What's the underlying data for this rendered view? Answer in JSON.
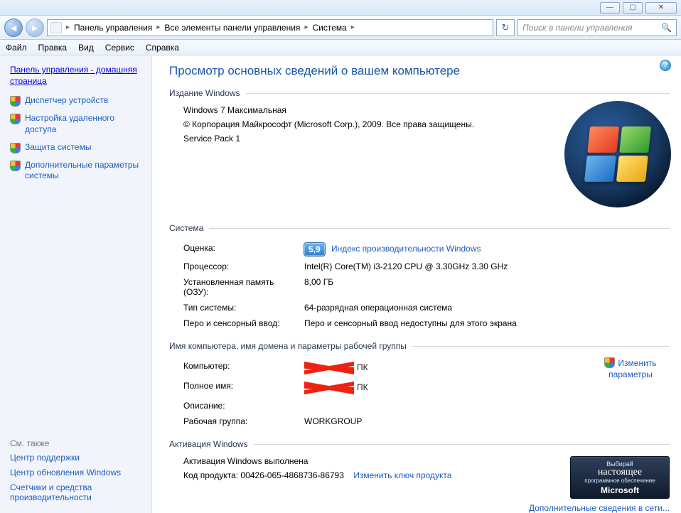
{
  "titlebar": {
    "min": "—",
    "max": "▢",
    "close": "✕"
  },
  "nav": {
    "crumbs": [
      "Панель управления",
      "Все элементы панели управления",
      "Система"
    ],
    "search_placeholder": "Поиск в панели управления"
  },
  "menu": [
    "Файл",
    "Правка",
    "Вид",
    "Сервис",
    "Справка"
  ],
  "sidebar": {
    "home": "Панель управления - домашняя страница",
    "items": [
      "Диспетчер устройств",
      "Настройка удаленного доступа",
      "Защита системы",
      "Дополнительные параметры системы"
    ],
    "also_label": "См. также",
    "also": [
      "Центр поддержки",
      "Центр обновления Windows",
      "Счетчики и средства производительности"
    ]
  },
  "page_title": "Просмотр основных сведений о вашем компьютере",
  "ed": {
    "legend": "Издание Windows",
    "name": "Windows 7 Максимальная",
    "copyright": "© Корпорация Майкрософт (Microsoft Corp.), 2009. Все права защищены.",
    "sp": "Service Pack 1"
  },
  "sys": {
    "legend": "Система",
    "rating_k": "Оценка:",
    "rating_v": "5,9",
    "rating_link": "Индекс производительности Windows",
    "cpu_k": "Процессор:",
    "cpu_v": "Intel(R) Core(TM) i3-2120 CPU @ 3.30GHz   3.30 GHz",
    "ram_k": "Установленная память (ОЗУ):",
    "ram_v": "8,00 ГБ",
    "type_k": "Тип системы:",
    "type_v": "64-разрядная операционная система",
    "pen_k": "Перо и сенсорный ввод:",
    "pen_v": "Перо и сенсорный ввод недоступны для этого экрана"
  },
  "dom": {
    "legend": "Имя компьютера, имя домена и параметры рабочей группы",
    "comp_k": "Компьютер:",
    "full_k": "Полное имя:",
    "suffix": "ПК",
    "desc_k": "Описание:",
    "wg_k": "Рабочая группа:",
    "wg_v": "WORKGROUP",
    "change": "Изменить параметры"
  },
  "act": {
    "legend": "Активация Windows",
    "status": "Активация Windows выполнена",
    "key_k": "Код продукта: ",
    "key_v": "00426-065-4868736-86793",
    "change_key": "Изменить ключ продукта",
    "net": "Дополнительные сведения в сети...",
    "badge1": "Выбирай",
    "badge2": "настоящее",
    "badge3": "программное обеспечение",
    "badge4": "Microsoft"
  }
}
